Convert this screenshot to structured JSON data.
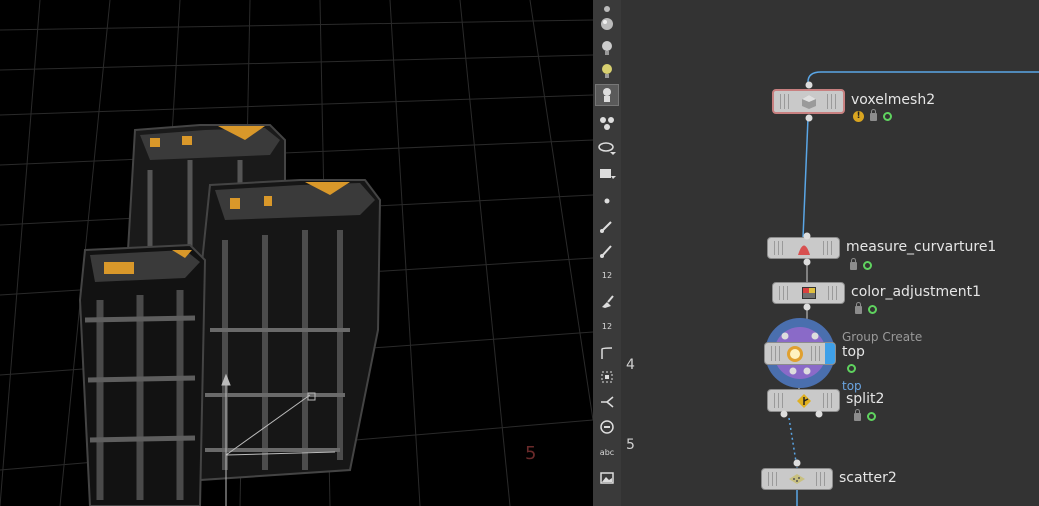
{
  "viewport": {
    "axis_labels": [
      "4",
      "5"
    ],
    "floor_label": "5"
  },
  "toolbar": {
    "tools": [
      {
        "name": "light-tool-icon"
      },
      {
        "name": "sphere-tool-icon"
      },
      {
        "name": "spot-light-icon"
      },
      {
        "name": "point-light-icon"
      },
      {
        "name": "skeleton-icon",
        "active": true
      },
      {
        "name": "components-icon"
      },
      {
        "name": "visibility-icon"
      },
      {
        "name": "camera-icon"
      },
      {
        "name": "point-display-icon"
      },
      {
        "name": "normal-display-icon"
      },
      {
        "name": "vector-display-icon"
      },
      {
        "name": "point-numbers-icon",
        "text": "12"
      },
      {
        "name": "brush-icon"
      },
      {
        "name": "primitive-numbers-icon",
        "text": "12"
      },
      {
        "name": "corner-icon"
      },
      {
        "name": "snap-icon"
      },
      {
        "name": "branch-icon"
      },
      {
        "name": "circle-display-icon"
      },
      {
        "name": "text-icon",
        "text": "abc"
      },
      {
        "name": "background-image-icon"
      }
    ]
  },
  "network": {
    "nodes": [
      {
        "id": "voxelmesh2",
        "label": "voxelmesh2"
      },
      {
        "id": "measure_curvarture1",
        "label": "measure_curvarture1"
      },
      {
        "id": "color_adjustment1",
        "label": "color_adjustment1"
      },
      {
        "id": "group_create",
        "label": "top",
        "sublabel": "Group Create"
      },
      {
        "id": "split2",
        "label": "split2",
        "tag": "top"
      },
      {
        "id": "scatter2",
        "label": "scatter2"
      }
    ],
    "colors": {
      "wire": "#5aa6e6",
      "selected_border": "#c88080",
      "display_flag": "#3ea0e8",
      "group_ring": "#4a6fae"
    }
  }
}
